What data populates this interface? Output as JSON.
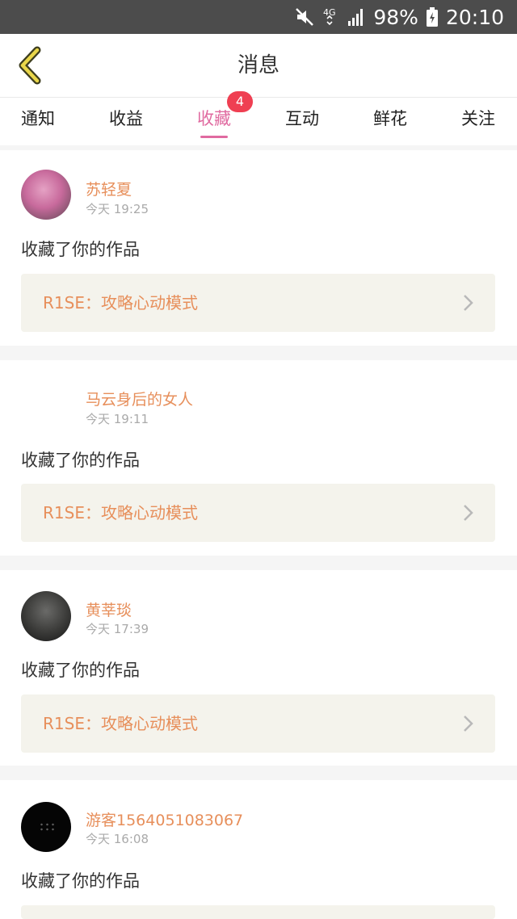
{
  "status_bar": {
    "battery": "98%",
    "time": "20:10",
    "network": "4G",
    "icons": [
      "mute-icon",
      "network-4g-icon",
      "signal-icon",
      "battery-charging-icon"
    ]
  },
  "header": {
    "title": "消息",
    "back_icon": "chevron-left-icon"
  },
  "tabs": [
    {
      "label": "通知"
    },
    {
      "label": "收益"
    },
    {
      "label": "收藏",
      "badge": "4"
    },
    {
      "label": "互动"
    },
    {
      "label": "鲜花"
    },
    {
      "label": "关注"
    }
  ],
  "active_tab": "收藏",
  "messages": [
    {
      "user": "苏轻夏",
      "time": "今天 19:25",
      "action": "收藏了你的作品",
      "work_title": "R1SE：攻略心动模式"
    },
    {
      "user": "马云身后的女人",
      "time": "今天 19:11",
      "action": "收藏了你的作品",
      "work_title": "R1SE：攻略心动模式"
    },
    {
      "user": "黄莘琰",
      "time": "今天 17:39",
      "action": "收藏了你的作品",
      "work_title": "R1SE：攻略心动模式"
    },
    {
      "user": "游客1564051083067",
      "time": "今天 16:08",
      "action": "收藏了你的作品",
      "work_title": ""
    }
  ],
  "colors": {
    "accent": "#e06aa0",
    "username": "#e78f5b",
    "badge": "#ef3f52",
    "work_bg": "#f4f3ec"
  }
}
